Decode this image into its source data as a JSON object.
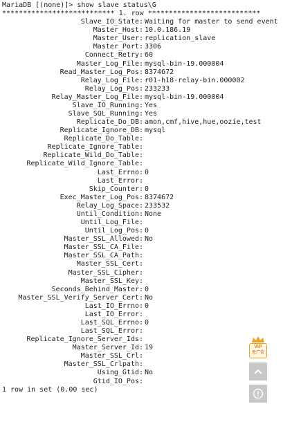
{
  "terminal": {
    "prompt_line": "MariaDB [(none)]> show slave status\\G",
    "row_header": "*************************** 1. row ***************************",
    "fields": [
      {
        "name": "Slave_IO_State",
        "value": "Waiting for master to send event"
      },
      {
        "name": "Master_Host",
        "value": "10.0.186.19"
      },
      {
        "name": "Master_User",
        "value": "replication_slave"
      },
      {
        "name": "Master_Port",
        "value": "3306"
      },
      {
        "name": "Connect_Retry",
        "value": "60"
      },
      {
        "name": "Master_Log_File",
        "value": "mysql-bin-19.000004"
      },
      {
        "name": "Read_Master_Log_Pos",
        "value": "8374672"
      },
      {
        "name": "Relay_Log_File",
        "value": "r01-h18-relay-bin.000002"
      },
      {
        "name": "Relay_Log_Pos",
        "value": "233233"
      },
      {
        "name": "Relay_Master_Log_File",
        "value": "mysql-bin-19.000004"
      },
      {
        "name": "Slave_IO_Running",
        "value": "Yes"
      },
      {
        "name": "Slave_SQL_Running",
        "value": "Yes"
      },
      {
        "name": "Replicate_Do_DB",
        "value": "amon,cmf,hive,hue,oozie,test"
      },
      {
        "name": "Replicate_Ignore_DB",
        "value": "mysql"
      },
      {
        "name": "Replicate_Do_Table",
        "value": ""
      },
      {
        "name": "Replicate_Ignore_Table",
        "value": ""
      },
      {
        "name": "Replicate_Wild_Do_Table",
        "value": ""
      },
      {
        "name": "Replicate_Wild_Ignore_Table",
        "value": ""
      },
      {
        "name": "Last_Errno",
        "value": "0"
      },
      {
        "name": "Last_Error",
        "value": ""
      },
      {
        "name": "Skip_Counter",
        "value": "0"
      },
      {
        "name": "Exec_Master_Log_Pos",
        "value": "8374672"
      },
      {
        "name": "Relay_Log_Space",
        "value": "233532"
      },
      {
        "name": "Until_Condition",
        "value": "None"
      },
      {
        "name": "Until_Log_File",
        "value": ""
      },
      {
        "name": "Until_Log_Pos",
        "value": "0"
      },
      {
        "name": "Master_SSL_Allowed",
        "value": "No"
      },
      {
        "name": "Master_SSL_CA_File",
        "value": ""
      },
      {
        "name": "Master_SSL_CA_Path",
        "value": ""
      },
      {
        "name": "Master_SSL_Cert",
        "value": ""
      },
      {
        "name": "Master_SSL_Cipher",
        "value": ""
      },
      {
        "name": "Master_SSL_Key",
        "value": ""
      },
      {
        "name": "Seconds_Behind_Master",
        "value": "0"
      },
      {
        "name": "Master_SSL_Verify_Server_Cert",
        "value": "No"
      },
      {
        "name": "Last_IO_Errno",
        "value": "0"
      },
      {
        "name": "Last_IO_Error",
        "value": ""
      },
      {
        "name": "Last_SQL_Errno",
        "value": "0"
      },
      {
        "name": "Last_SQL_Error",
        "value": ""
      },
      {
        "name": "Replicate_Ignore_Server_Ids",
        "value": ""
      },
      {
        "name": "Master_Server_Id",
        "value": "19"
      },
      {
        "name": "Master_SSL_Crl",
        "value": ""
      },
      {
        "name": "Master_SSL_Crlpath",
        "value": ""
      },
      {
        "name": "Using_Gtid",
        "value": "No"
      },
      {
        "name": "Gtid_IO_Pos",
        "value": ""
      }
    ],
    "footer_line": "1 row in set (0.00 sec)"
  },
  "side_widgets": {
    "vip_label": "VIP",
    "vip_sublabel": "免广告",
    "vip_icon": "crown-icon",
    "scroll_top_icon": "chevron-up-icon",
    "info_icon": "info-circle-icon",
    "accent_color": "#f0a020",
    "button_color": "#c8c8c8"
  }
}
